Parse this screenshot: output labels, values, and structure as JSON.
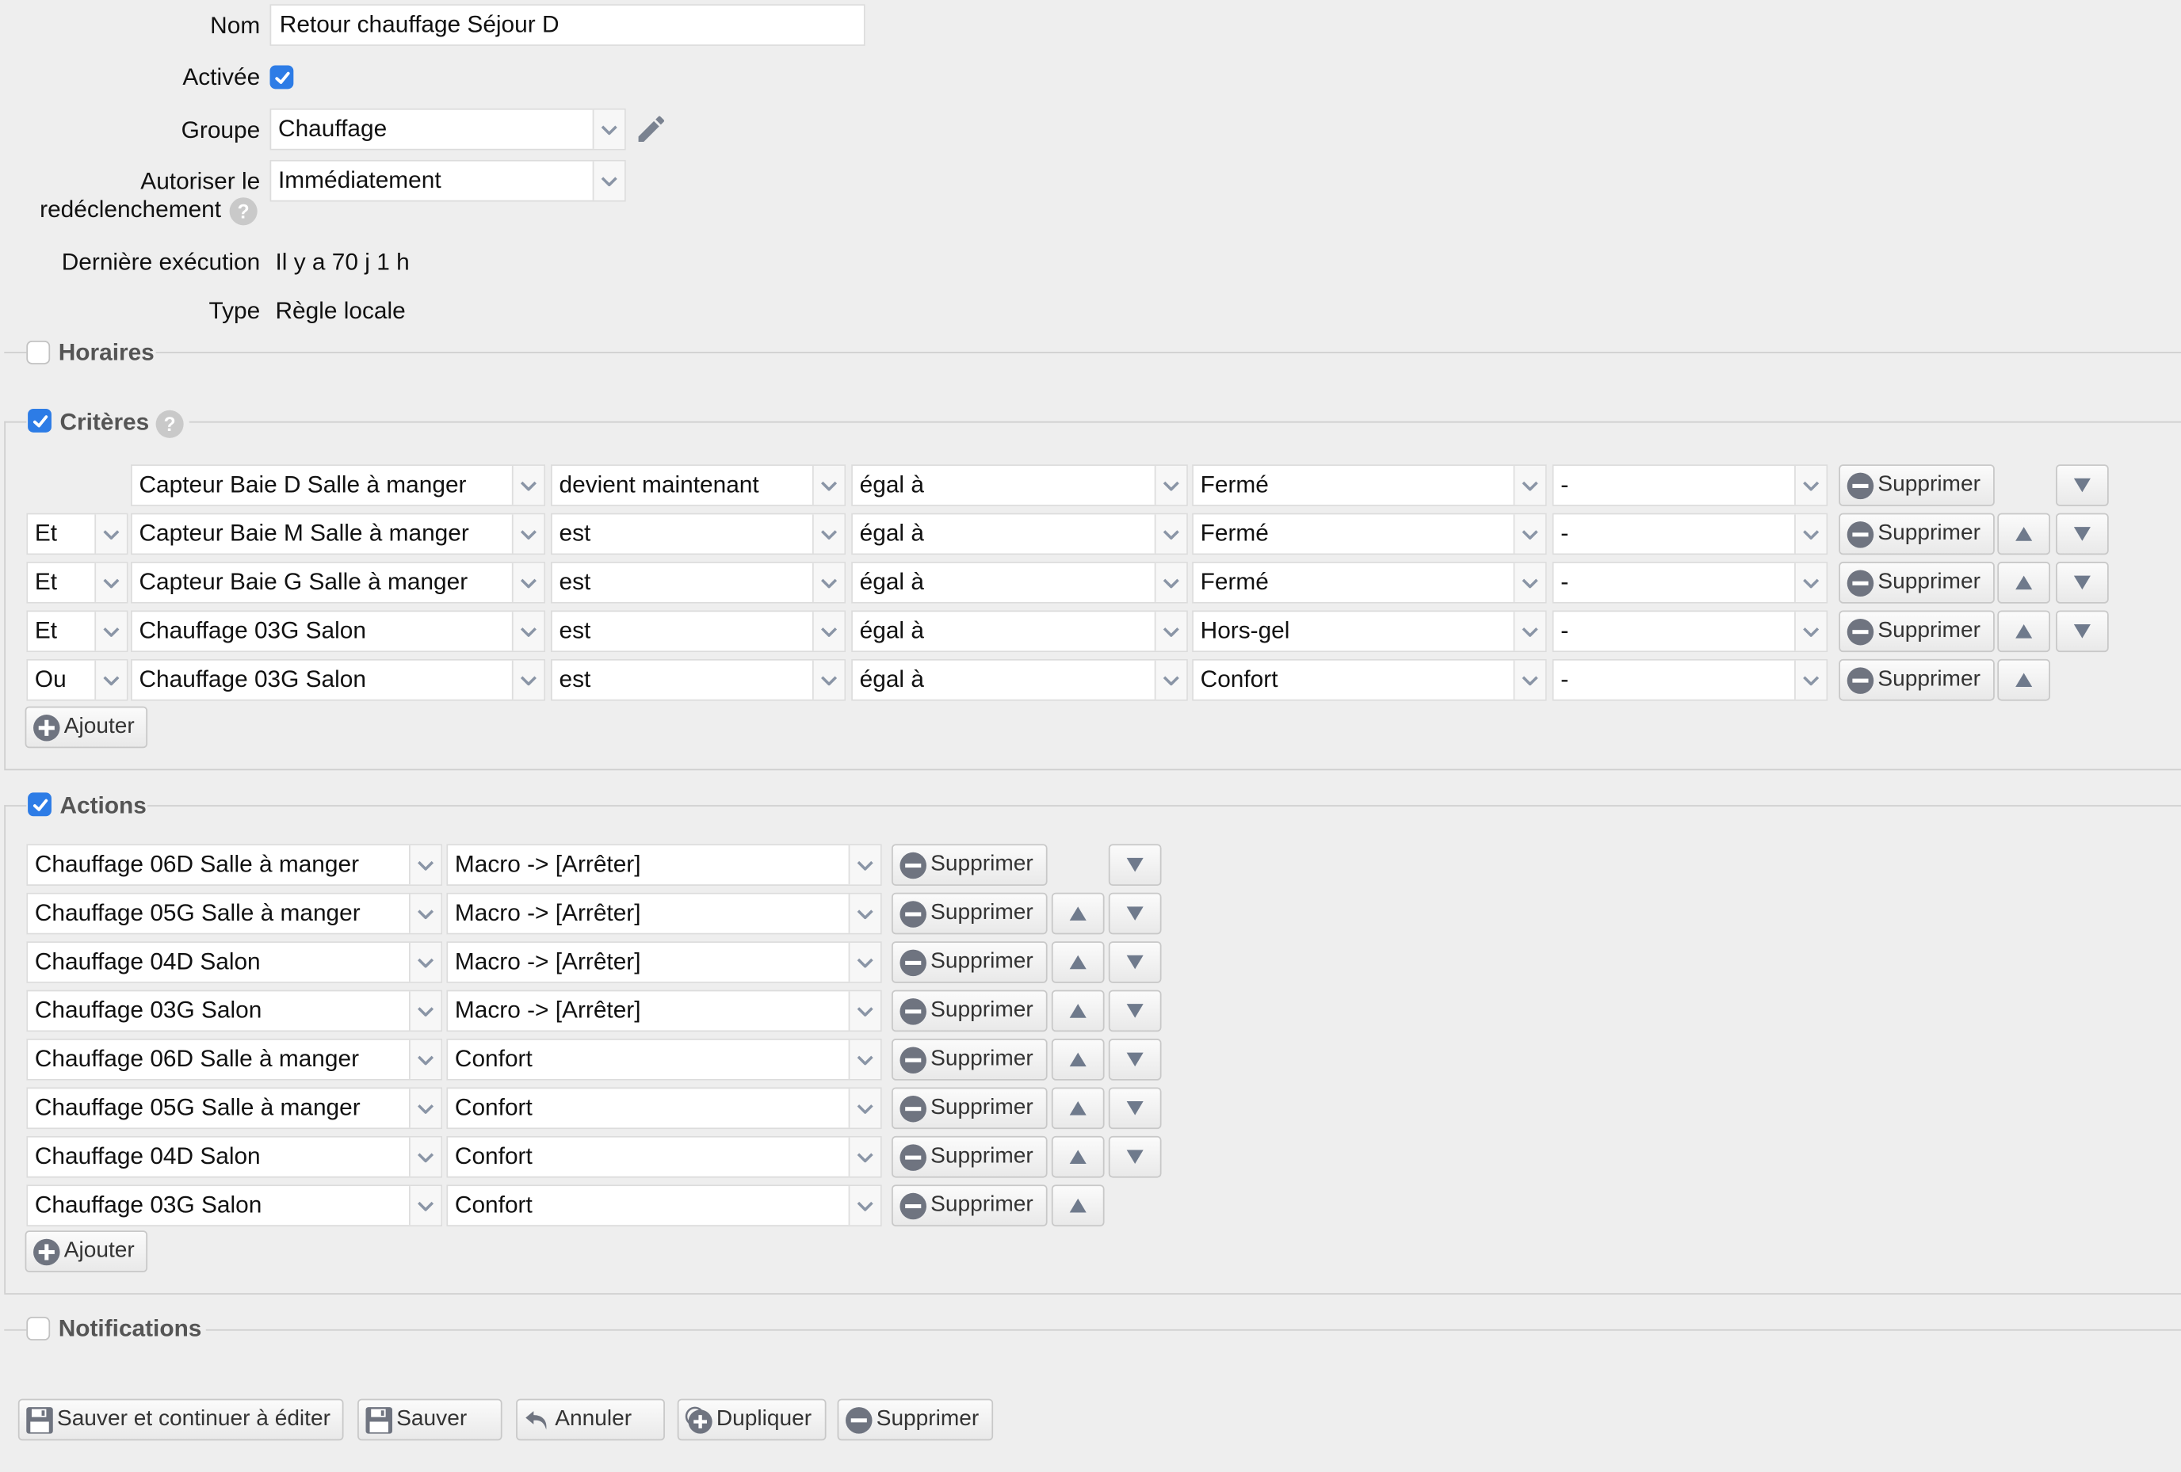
{
  "form": {
    "name_label": "Nom",
    "name_value": "Retour chauffage Séjour D",
    "active_label": "Activée",
    "active_checked": true,
    "group_label": "Groupe",
    "group_value": "Chauffage",
    "retrigger_label_line1": "Autoriser le",
    "retrigger_label_line2": "redéclenchement",
    "retrigger_value": "Immédiatement",
    "last_run_label": "Dernière exécution",
    "last_run_value": "Il y a 70 j 1 h",
    "type_label": "Type",
    "type_value": "Règle locale"
  },
  "sections": {
    "horaires": {
      "title": "Horaires",
      "checked": false
    },
    "criteres": {
      "title": "Critères",
      "checked": true
    },
    "actions": {
      "title": "Actions",
      "checked": true
    },
    "notifications": {
      "title": "Notifications",
      "checked": false
    }
  },
  "criteria": [
    {
      "conj": "",
      "device": "Capteur Baie D Salle à manger",
      "event": "devient maintenant",
      "op": "égal à",
      "value": "Fermé",
      "extra": "-",
      "up": false,
      "down": true
    },
    {
      "conj": "Et",
      "device": "Capteur Baie M Salle à manger",
      "event": "est",
      "op": "égal à",
      "value": "Fermé",
      "extra": "-",
      "up": true,
      "down": true
    },
    {
      "conj": "Et",
      "device": "Capteur Baie G Salle à manger",
      "event": "est",
      "op": "égal à",
      "value": "Fermé",
      "extra": "-",
      "up": true,
      "down": true
    },
    {
      "conj": "Et",
      "device": "Chauffage 03G Salon",
      "event": "est",
      "op": "égal à",
      "value": "Hors-gel",
      "extra": "-",
      "up": true,
      "down": true
    },
    {
      "conj": "Ou",
      "device": "Chauffage 03G Salon",
      "event": "est",
      "op": "égal à",
      "value": "Confort",
      "extra": "-",
      "up": true,
      "down": false
    }
  ],
  "actions": [
    {
      "device": "Chauffage 06D Salle à manger",
      "command": "Macro -> [Arrêter]",
      "up": false,
      "down": true
    },
    {
      "device": "Chauffage 05G Salle à manger",
      "command": "Macro -> [Arrêter]",
      "up": true,
      "down": true
    },
    {
      "device": "Chauffage 04D Salon",
      "command": "Macro -> [Arrêter]",
      "up": true,
      "down": true
    },
    {
      "device": "Chauffage 03G Salon",
      "command": "Macro -> [Arrêter]",
      "up": true,
      "down": true
    },
    {
      "device": "Chauffage 06D Salle à manger",
      "command": "Confort",
      "up": true,
      "down": true
    },
    {
      "device": "Chauffage 05G Salle à manger",
      "command": "Confort",
      "up": true,
      "down": true
    },
    {
      "device": "Chauffage 04D Salon",
      "command": "Confort",
      "up": true,
      "down": true
    },
    {
      "device": "Chauffage 03G Salon",
      "command": "Confort",
      "up": true,
      "down": false
    }
  ],
  "labels": {
    "delete": "Supprimer",
    "add": "Ajouter"
  },
  "footer": {
    "save_continue": "Sauver et continuer à éditer",
    "save": "Sauver",
    "cancel": "Annuler",
    "duplicate": "Dupliquer",
    "delete": "Supprimer"
  },
  "colors": {
    "accent": "#2d7ce6",
    "icon_grey": "#6f7480",
    "background": "#eeeeee"
  },
  "icons": {
    "delete": "minus-circle-icon",
    "add": "plus-circle-icon",
    "save": "floppy-disk-icon",
    "cancel": "undo-arrow-icon",
    "edit": "pencil-icon",
    "up": "triangle-up-icon",
    "down": "triangle-down-icon"
  }
}
